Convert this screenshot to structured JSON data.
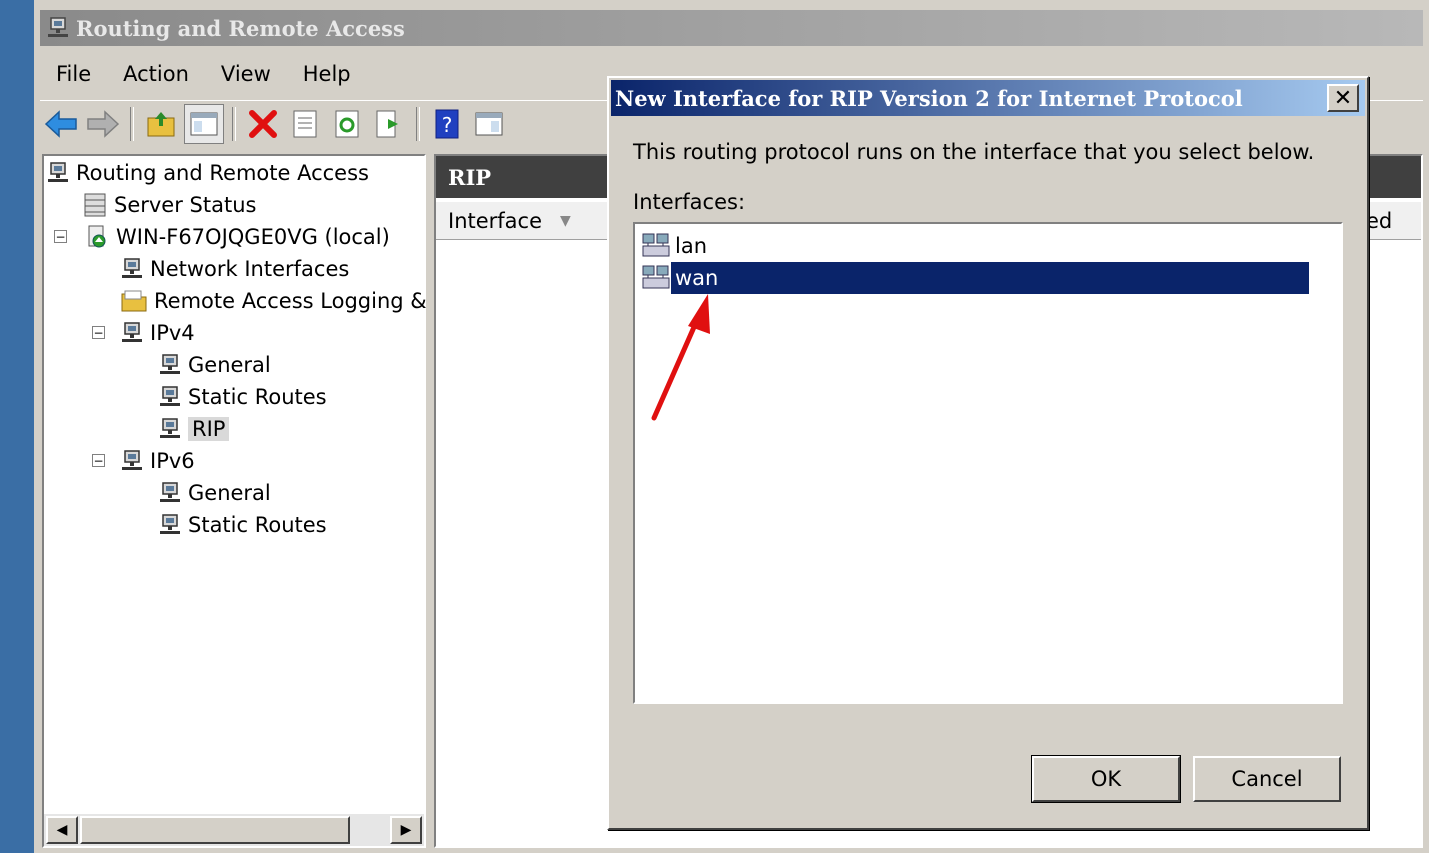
{
  "window": {
    "title": "Routing and Remote Access"
  },
  "menubar": {
    "items": [
      "File",
      "Action",
      "View",
      "Help"
    ]
  },
  "toolbar": {
    "buttons": [
      "back-icon",
      "forward-icon",
      "up-folder-icon",
      "show-hide-tree-icon",
      "delete-icon",
      "properties-icon",
      "refresh-icon",
      "export-list-icon",
      "help-icon",
      "show-action-pane-icon"
    ]
  },
  "tree": {
    "root": "Routing and Remote Access",
    "server_status": "Server Status",
    "server": "WIN-F67OJQGE0VG (local)",
    "network_interfaces": "Network Interfaces",
    "remote_access_logging": "Remote Access Logging & P",
    "ipv4": "IPv4",
    "ipv4_general": "General",
    "ipv4_static_routes": "Static Routes",
    "ipv4_rip": "RIP",
    "ipv6": "IPv6",
    "ipv6_general": "General",
    "ipv6_static_routes": "Static Routes"
  },
  "right_pane": {
    "header": "RIP",
    "column_interface": "Interface",
    "column_right_partial": "ed"
  },
  "dialog": {
    "title": "New Interface for RIP Version 2 for Internet Protocol",
    "description": "This routing protocol runs on the interface that you select below.",
    "interfaces_label": "Interfaces:",
    "interfaces": [
      {
        "name": "lan",
        "selected": false
      },
      {
        "name": "wan",
        "selected": true
      }
    ],
    "ok_label": "OK",
    "cancel_label": "Cancel",
    "close_label": "✕"
  },
  "colors": {
    "selection": "#0a246a",
    "annotation_arrow": "#e01010"
  }
}
